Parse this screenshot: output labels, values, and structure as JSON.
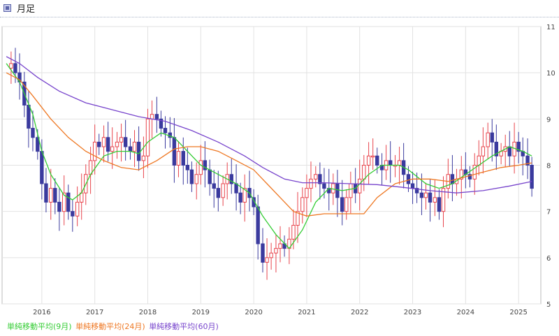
{
  "header": {
    "title": "月足"
  },
  "chart_data": {
    "type": "candlestick",
    "title": "",
    "xlabel": "",
    "ylabel": "",
    "ylim": [
      5,
      11
    ],
    "xlim": [
      2015.25,
      2025.42
    ],
    "y_ticks": [
      "5",
      "6",
      "7",
      "8",
      "9",
      "10",
      "11"
    ],
    "x_ticks": [
      {
        "label": "2016",
        "x": 2016.0
      },
      {
        "label": "2017",
        "x": 2017.0
      },
      {
        "label": "2018",
        "x": 2018.0
      },
      {
        "label": "2019",
        "x": 2019.0
      },
      {
        "label": "2020",
        "x": 2020.0
      },
      {
        "label": "2021",
        "x": 2021.0
      },
      {
        "label": "2022",
        "x": 2022.0
      },
      {
        "label": "2023",
        "x": 2023.0
      },
      {
        "label": "2024",
        "x": 2024.0
      },
      {
        "label": "2025",
        "x": 2025.0
      }
    ],
    "grid": true,
    "colors": {
      "up": "#e8444c",
      "down": "#3a3a9e",
      "ma9": "#33cc33",
      "ma24": "#ee7722",
      "ma60": "#7744cc"
    },
    "candle_close_points": [
      [
        2015.33,
        10.1
      ],
      [
        2015.42,
        10.2
      ],
      [
        2015.5,
        10.0
      ],
      [
        2015.58,
        9.8
      ],
      [
        2015.67,
        9.3
      ],
      [
        2015.75,
        8.8
      ],
      [
        2015.83,
        8.6
      ],
      [
        2015.92,
        8.3
      ],
      [
        2016.0,
        7.6
      ],
      [
        2016.08,
        7.2
      ],
      [
        2016.17,
        7.5
      ],
      [
        2016.25,
        7.2
      ],
      [
        2016.33,
        7.0
      ],
      [
        2016.42,
        7.4
      ],
      [
        2016.5,
        7.0
      ],
      [
        2016.58,
        6.9
      ],
      [
        2016.67,
        7.2
      ],
      [
        2016.75,
        7.4
      ],
      [
        2016.83,
        7.8
      ],
      [
        2016.92,
        8.1
      ],
      [
        2017.0,
        8.5
      ],
      [
        2017.08,
        8.4
      ],
      [
        2017.17,
        8.6
      ],
      [
        2017.25,
        8.3
      ],
      [
        2017.33,
        8.4
      ],
      [
        2017.42,
        8.5
      ],
      [
        2017.5,
        8.6
      ],
      [
        2017.58,
        8.4
      ],
      [
        2017.67,
        8.3
      ],
      [
        2017.75,
        8.5
      ],
      [
        2017.83,
        8.1
      ],
      [
        2017.92,
        8.2
      ],
      [
        2018.0,
        9.0
      ],
      [
        2018.08,
        9.1
      ],
      [
        2018.17,
        9.0
      ],
      [
        2018.25,
        8.8
      ],
      [
        2018.33,
        8.7
      ],
      [
        2018.42,
        8.6
      ],
      [
        2018.5,
        8.0
      ],
      [
        2018.58,
        8.3
      ],
      [
        2018.67,
        8.0
      ],
      [
        2018.75,
        7.9
      ],
      [
        2018.83,
        7.6
      ],
      [
        2018.92,
        7.8
      ],
      [
        2019.0,
        8.1
      ],
      [
        2019.08,
        7.9
      ],
      [
        2019.17,
        7.6
      ],
      [
        2019.25,
        7.5
      ],
      [
        2019.33,
        7.3
      ],
      [
        2019.42,
        7.6
      ],
      [
        2019.5,
        7.8
      ],
      [
        2019.58,
        7.6
      ],
      [
        2019.67,
        7.4
      ],
      [
        2019.75,
        7.2
      ],
      [
        2019.83,
        7.5
      ],
      [
        2019.92,
        7.3
      ],
      [
        2020.0,
        7.1
      ],
      [
        2020.08,
        6.3
      ],
      [
        2020.17,
        5.9
      ],
      [
        2020.25,
        6.0
      ],
      [
        2020.33,
        6.1
      ],
      [
        2020.42,
        6.2
      ],
      [
        2020.5,
        6.3
      ],
      [
        2020.58,
        6.2
      ],
      [
        2020.67,
        6.4
      ],
      [
        2020.75,
        6.7
      ],
      [
        2020.83,
        7.0
      ],
      [
        2020.92,
        7.3
      ],
      [
        2021.0,
        7.5
      ],
      [
        2021.08,
        7.7
      ],
      [
        2021.17,
        7.8
      ],
      [
        2021.25,
        7.6
      ],
      [
        2021.33,
        7.5
      ],
      [
        2021.42,
        7.4
      ],
      [
        2021.5,
        7.6
      ],
      [
        2021.58,
        7.3
      ],
      [
        2021.67,
        7.0
      ],
      [
        2021.75,
        7.3
      ],
      [
        2021.83,
        7.6
      ],
      [
        2021.92,
        7.4
      ],
      [
        2022.0,
        7.7
      ],
      [
        2022.08,
        8.0
      ],
      [
        2022.17,
        8.2
      ],
      [
        2022.25,
        8.2
      ],
      [
        2022.33,
        8.0
      ],
      [
        2022.42,
        7.9
      ],
      [
        2022.5,
        8.1
      ],
      [
        2022.58,
        8.0
      ],
      [
        2022.67,
        8.0
      ],
      [
        2022.75,
        8.1
      ],
      [
        2022.83,
        7.8
      ],
      [
        2022.92,
        7.6
      ],
      [
        2023.0,
        7.5
      ],
      [
        2023.08,
        7.4
      ],
      [
        2023.17,
        7.3
      ],
      [
        2023.25,
        7.4
      ],
      [
        2023.33,
        7.2
      ],
      [
        2023.42,
        7.3
      ],
      [
        2023.5,
        7.0
      ],
      [
        2023.58,
        7.5
      ],
      [
        2023.67,
        7.8
      ],
      [
        2023.75,
        7.6
      ],
      [
        2023.83,
        7.7
      ],
      [
        2023.92,
        7.9
      ],
      [
        2024.0,
        7.8
      ],
      [
        2024.08,
        7.7
      ],
      [
        2024.17,
        8.0
      ],
      [
        2024.25,
        8.2
      ],
      [
        2024.33,
        8.4
      ],
      [
        2024.42,
        8.7
      ],
      [
        2024.5,
        8.5
      ],
      [
        2024.58,
        8.2
      ],
      [
        2024.67,
        8.3
      ],
      [
        2024.75,
        8.4
      ],
      [
        2024.83,
        8.2
      ],
      [
        2024.92,
        8.5
      ],
      [
        2025.0,
        8.3
      ],
      [
        2025.08,
        8.2
      ],
      [
        2025.17,
        8.0
      ],
      [
        2025.25,
        7.5
      ]
    ],
    "series": [
      {
        "name": "単純移動平均(9月)",
        "values": [
          [
            2015.33,
            10.2
          ],
          [
            2015.58,
            9.8
          ],
          [
            2015.83,
            9.1
          ],
          [
            2016.0,
            8.3
          ],
          [
            2016.17,
            7.8
          ],
          [
            2016.42,
            7.35
          ],
          [
            2016.58,
            7.25
          ],
          [
            2016.75,
            7.4
          ],
          [
            2016.92,
            7.8
          ],
          [
            2017.17,
            8.2
          ],
          [
            2017.42,
            8.3
          ],
          [
            2017.67,
            8.3
          ],
          [
            2017.83,
            8.25
          ],
          [
            2018.0,
            8.5
          ],
          [
            2018.25,
            8.7
          ],
          [
            2018.5,
            8.6
          ],
          [
            2018.75,
            8.3
          ],
          [
            2019.0,
            8.0
          ],
          [
            2019.33,
            7.8
          ],
          [
            2019.67,
            7.6
          ],
          [
            2019.92,
            7.4
          ],
          [
            2020.17,
            6.9
          ],
          [
            2020.42,
            6.5
          ],
          [
            2020.67,
            6.2
          ],
          [
            2020.92,
            6.6
          ],
          [
            2021.17,
            7.2
          ],
          [
            2021.42,
            7.5
          ],
          [
            2021.67,
            7.45
          ],
          [
            2021.92,
            7.5
          ],
          [
            2022.17,
            7.8
          ],
          [
            2022.42,
            8.0
          ],
          [
            2022.75,
            8.0
          ],
          [
            2022.92,
            7.9
          ],
          [
            2023.25,
            7.6
          ],
          [
            2023.5,
            7.5
          ],
          [
            2023.75,
            7.6
          ],
          [
            2024.0,
            7.8
          ],
          [
            2024.25,
            8.0
          ],
          [
            2024.5,
            8.2
          ],
          [
            2024.83,
            8.4
          ],
          [
            2025.08,
            8.3
          ],
          [
            2025.25,
            8.2
          ]
        ]
      },
      {
        "name": "単純移動平均(24月)",
        "values": [
          [
            2015.33,
            10.0
          ],
          [
            2015.58,
            9.85
          ],
          [
            2015.83,
            9.5
          ],
          [
            2016.17,
            9.0
          ],
          [
            2016.5,
            8.6
          ],
          [
            2016.83,
            8.3
          ],
          [
            2017.17,
            8.1
          ],
          [
            2017.5,
            7.95
          ],
          [
            2017.83,
            7.9
          ],
          [
            2018.17,
            8.1
          ],
          [
            2018.5,
            8.35
          ],
          [
            2018.75,
            8.4
          ],
          [
            2019.0,
            8.4
          ],
          [
            2019.33,
            8.3
          ],
          [
            2019.67,
            8.1
          ],
          [
            2020.0,
            7.9
          ],
          [
            2020.25,
            7.6
          ],
          [
            2020.5,
            7.3
          ],
          [
            2020.75,
            7.0
          ],
          [
            2021.0,
            6.9
          ],
          [
            2021.33,
            6.95
          ],
          [
            2021.67,
            6.95
          ],
          [
            2022.08,
            6.95
          ],
          [
            2022.33,
            7.3
          ],
          [
            2022.67,
            7.6
          ],
          [
            2023.0,
            7.7
          ],
          [
            2023.33,
            7.7
          ],
          [
            2023.67,
            7.65
          ],
          [
            2024.0,
            7.75
          ],
          [
            2024.33,
            7.85
          ],
          [
            2024.67,
            7.95
          ],
          [
            2025.0,
            8.0
          ],
          [
            2025.25,
            8.05
          ]
        ]
      },
      {
        "name": "単純移動平均(60月)",
        "values": [
          [
            2015.33,
            10.35
          ],
          [
            2015.58,
            10.2
          ],
          [
            2015.92,
            9.9
          ],
          [
            2016.33,
            9.6
          ],
          [
            2016.83,
            9.35
          ],
          [
            2017.33,
            9.2
          ],
          [
            2017.83,
            9.05
          ],
          [
            2018.33,
            8.95
          ],
          [
            2018.83,
            8.75
          ],
          [
            2019.33,
            8.5
          ],
          [
            2019.83,
            8.2
          ],
          [
            2020.17,
            7.95
          ],
          [
            2020.58,
            7.7
          ],
          [
            2020.92,
            7.62
          ],
          [
            2021.33,
            7.62
          ],
          [
            2021.83,
            7.6
          ],
          [
            2022.33,
            7.58
          ],
          [
            2022.83,
            7.52
          ],
          [
            2023.33,
            7.45
          ],
          [
            2023.83,
            7.4
          ],
          [
            2024.33,
            7.45
          ],
          [
            2024.83,
            7.55
          ],
          [
            2025.25,
            7.65
          ]
        ]
      }
    ]
  }
}
